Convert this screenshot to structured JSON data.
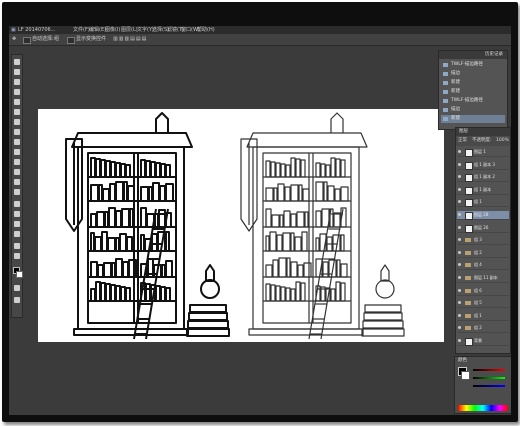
{
  "app": {
    "document_tab": "LF 20140706...",
    "menu": [
      "文件(F)",
      "编辑(E)",
      "图像(I)",
      "图层(L)",
      "文字(Y)",
      "选择(S)",
      "滤镜(T)",
      "3D(D)",
      "视图(V)",
      "窗口(W)",
      "帮助(H)"
    ]
  },
  "options_bar": {
    "items": [
      "自动选择:",
      "组",
      "显示变换控件"
    ]
  },
  "history_panel": {
    "title": "历史记录",
    "items": [
      {
        "label": "TWLF-描边路径"
      },
      {
        "label": "描边"
      },
      {
        "label": "新建"
      },
      {
        "label": "新建"
      },
      {
        "label": "TWLF-描边路径"
      },
      {
        "label": "描边"
      },
      {
        "label": "新建"
      }
    ],
    "active_index": 6
  },
  "layers_panel": {
    "title": "图层",
    "blend_mode": "正常",
    "opacity_label": "不透明度:",
    "opacity": "100%",
    "fill_label": "填充:",
    "fill": "100%",
    "layers": [
      {
        "name": "图层 1",
        "kind": "layer"
      },
      {
        "name": "组 1 副本 3",
        "kind": "layer"
      },
      {
        "name": "组 1 副本 2",
        "kind": "layer"
      },
      {
        "name": "组 1 副本",
        "kind": "layer"
      },
      {
        "name": "组 1",
        "kind": "layer"
      },
      {
        "name": "图层 28",
        "kind": "layer"
      },
      {
        "name": "图层 26",
        "kind": "layer"
      },
      {
        "name": "组 3",
        "kind": "group"
      },
      {
        "name": "组 2",
        "kind": "group"
      },
      {
        "name": "组 4",
        "kind": "group"
      },
      {
        "name": "图层 11 副本",
        "kind": "group"
      },
      {
        "name": "组 6",
        "kind": "group"
      },
      {
        "name": "组 5",
        "kind": "group"
      },
      {
        "name": "组 1",
        "kind": "group"
      },
      {
        "name": "组 2",
        "kind": "group"
      },
      {
        "name": "背景",
        "kind": "layer"
      }
    ],
    "selected_index": 5
  },
  "color_panel": {
    "title": "颜色",
    "foreground": "#000000",
    "background": "#ffffff"
  },
  "colors": {
    "bezel": "#0e0e0e",
    "workspace": "#3b3b3b",
    "panel": "#535353",
    "selection": "#7d8ea8",
    "canvas": "#ffffff"
  }
}
